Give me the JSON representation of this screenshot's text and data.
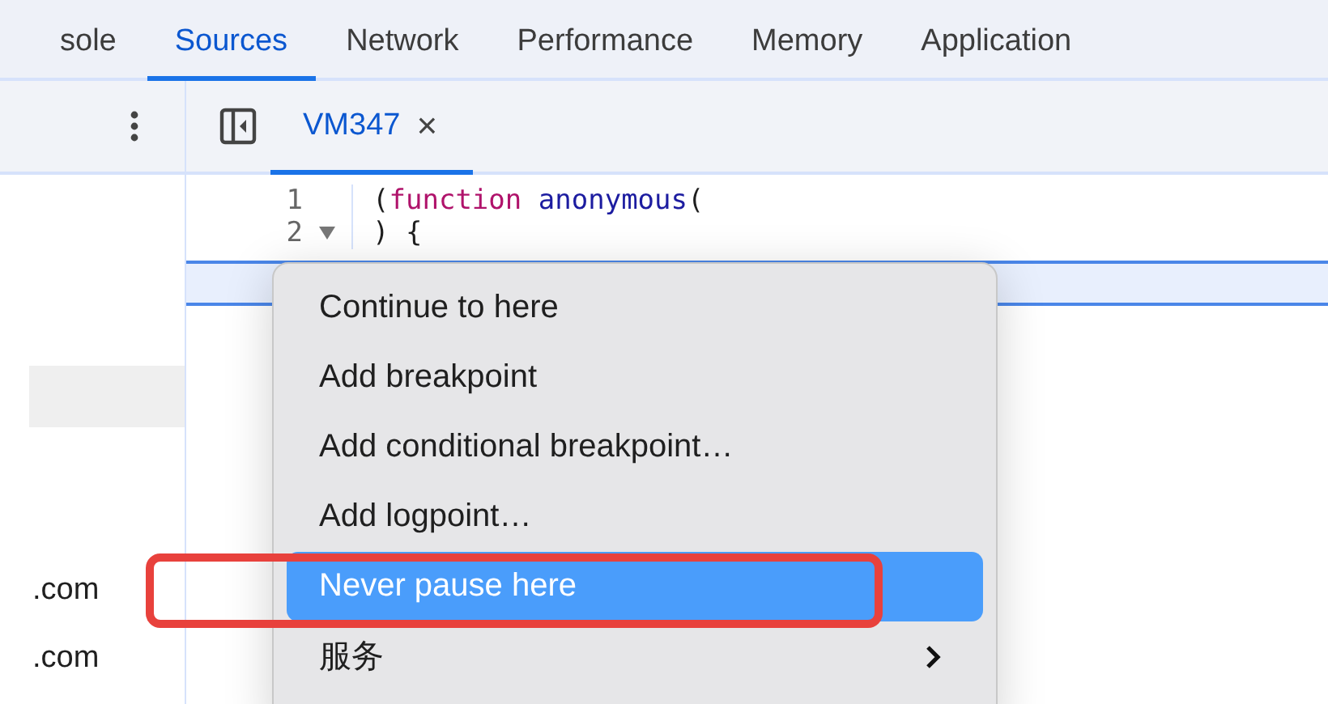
{
  "tabs": [
    {
      "label": "sole",
      "selected": false
    },
    {
      "label": "Sources",
      "selected": true
    },
    {
      "label": "Network",
      "selected": false
    },
    {
      "label": "Performance",
      "selected": false
    },
    {
      "label": "Memory",
      "selected": false
    },
    {
      "label": "Application",
      "selected": false
    }
  ],
  "file_tabs": [
    {
      "label": "VM347",
      "selected": true,
      "close": "×"
    }
  ],
  "code_lines": [
    {
      "number": "1",
      "foldable": false,
      "tokens": [
        {
          "kind": "punct",
          "text": "("
        },
        {
          "kind": "keyword",
          "text": "function"
        },
        {
          "kind": "name",
          "text": "anonymous"
        },
        {
          "kind": "punct",
          "text": "("
        }
      ]
    },
    {
      "number": "2",
      "foldable": true,
      "tokens": [
        {
          "kind": "punct",
          "text": ") {"
        }
      ]
    }
  ],
  "sidebar_rows": [
    {
      "label": ".com"
    },
    {
      "label": ".com"
    }
  ],
  "context_menu": {
    "items": [
      {
        "label": "Continue to here",
        "selected": false,
        "submenu": false
      },
      {
        "label": "Add breakpoint",
        "selected": false,
        "submenu": false
      },
      {
        "label": "Add conditional breakpoint…",
        "selected": false,
        "submenu": false
      },
      {
        "label": "Add logpoint…",
        "selected": false,
        "submenu": false
      },
      {
        "label": "Never pause here",
        "selected": true,
        "submenu": false
      },
      {
        "label": "服务",
        "selected": false,
        "submenu": true
      }
    ]
  },
  "annotation": {
    "kind": "outline"
  }
}
